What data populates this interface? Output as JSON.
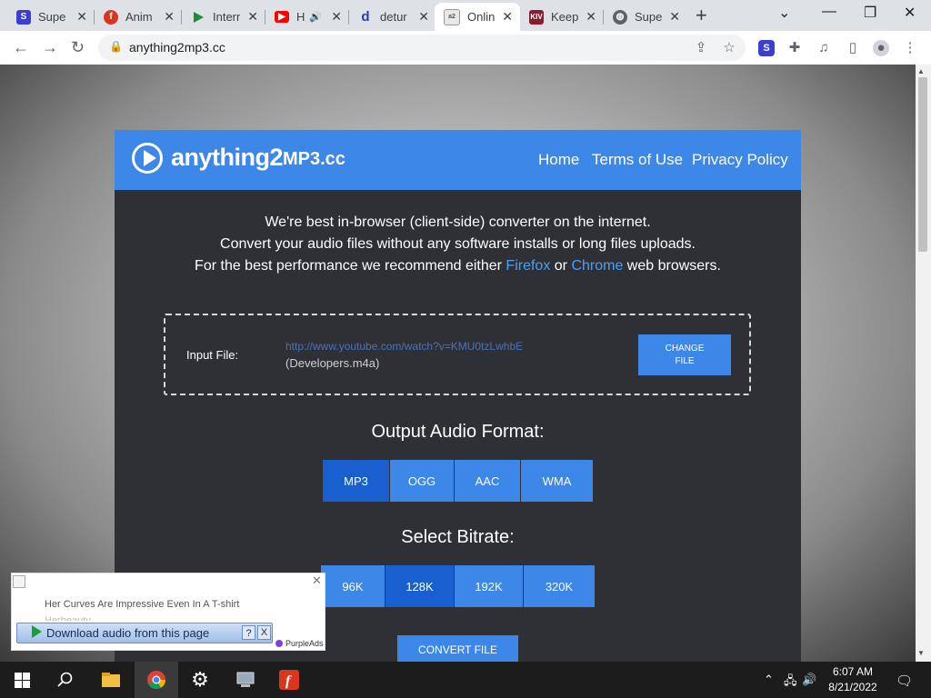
{
  "browser": {
    "tabs": [
      {
        "label": "Super",
        "icon": "super-icon",
        "color": "#3b3fd1"
      },
      {
        "label": "Anim",
        "icon": "flash-icon",
        "color": "#d9361f"
      },
      {
        "label": "Interr",
        "icon": "play-icon",
        "color": "#1a8f3a"
      },
      {
        "label": "H",
        "icon": "youtube-icon",
        "color": "#ff0000"
      },
      {
        "label": "detur",
        "icon": "d-icon",
        "color": "#2a3cb0"
      },
      {
        "label": "Onlin",
        "icon": "a2m-icon",
        "color": "#777777"
      },
      {
        "label": "Keep",
        "icon": "kiv-icon",
        "color": "#8a1b2c"
      },
      {
        "label": "Supe",
        "icon": "globe-icon",
        "color": "#5f6368"
      }
    ],
    "url": "anything2mp3.cc"
  },
  "site": {
    "logo_main": "anything2",
    "logo_suffix": "MP3.cc",
    "nav": [
      "Home",
      "Terms of Use",
      "Privacy Policy"
    ],
    "intro_line1": "We're best in-browser (client-side) converter on the internet.",
    "intro_line2": "Convert your audio files without any software installs or long files uploads.",
    "intro_line3_pre": "For the best performance we recommend either ",
    "intro_firefox": "Firefox",
    "intro_or": " or ",
    "intro_chrome": "Chrome",
    "intro_line3_post": " web browsers.",
    "input_label": "Input File:",
    "input_url": "http://www.youtube.com/watch?v=KMU0tzLwhbE",
    "input_filename": "(Developers.m4a)",
    "change_file_label": "CHANGE FILE",
    "output_title": "Output Audio Format:",
    "formats": [
      "MP3",
      "OGG",
      "AAC",
      "WMA"
    ],
    "selected_format": "MP3",
    "bitrate_title": "Select Bitrate:",
    "bitrates": [
      "96K",
      "128K",
      "192K",
      "320K"
    ],
    "selected_bitrate": "128K",
    "convert_label": "CONVERT FILE"
  },
  "ad": {
    "headline": "Her Curves Are Impressive Even In A T-shirt",
    "sub": "Herbeauty",
    "download_label": "Download audio from this page",
    "help_label": "?",
    "close_label": "X",
    "brand": "PurpleAds"
  },
  "taskbar": {
    "time": "6:07 AM",
    "date": "8/21/2022"
  },
  "colors": {
    "accent": "#3d87e8",
    "accent_selected": "#1a5fcf",
    "card_bg": "#2f3035",
    "link": "#4a9ff5"
  }
}
